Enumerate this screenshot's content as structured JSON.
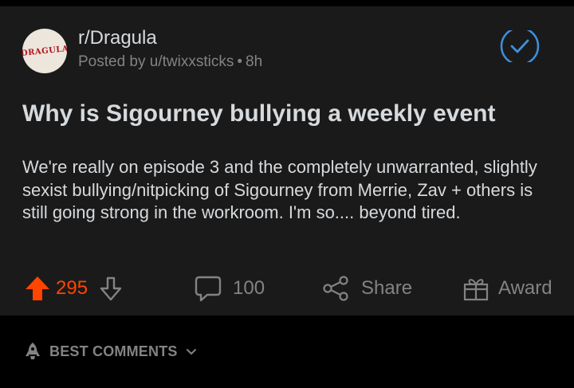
{
  "post": {
    "subreddit": "r/Dragula",
    "avatar_text": "DRAGULA",
    "posted_by": "Posted by u/twixxsticks",
    "separator": "•",
    "age": "8h",
    "title": "Why is Sigourney bullying a weekly event",
    "body": "We're really on episode 3 and the completely unwarranted, slightly sexist bullying/nitpicking of Sigourney from Merrie, Zav + others is still going strong in the workroom. I'm so.... beyond tired."
  },
  "actions": {
    "upvotes": "295",
    "comments": "100",
    "share_label": "Share",
    "award_label": "Award"
  },
  "comments_section": {
    "sort_label": "BEST COMMENTS"
  },
  "colors": {
    "upvote_active": "#ff4500",
    "joined_accent": "#3d8fdd",
    "muted_text": "#818384"
  },
  "icons": {
    "upvote": "upvote-arrow-icon",
    "downvote": "downvote-arrow-icon",
    "comment": "comment-bubble-icon",
    "share": "share-icon",
    "award": "award-gift-icon",
    "joined": "joined-check-icon",
    "sort": "rocket-icon",
    "dropdown": "chevron-down-icon"
  }
}
